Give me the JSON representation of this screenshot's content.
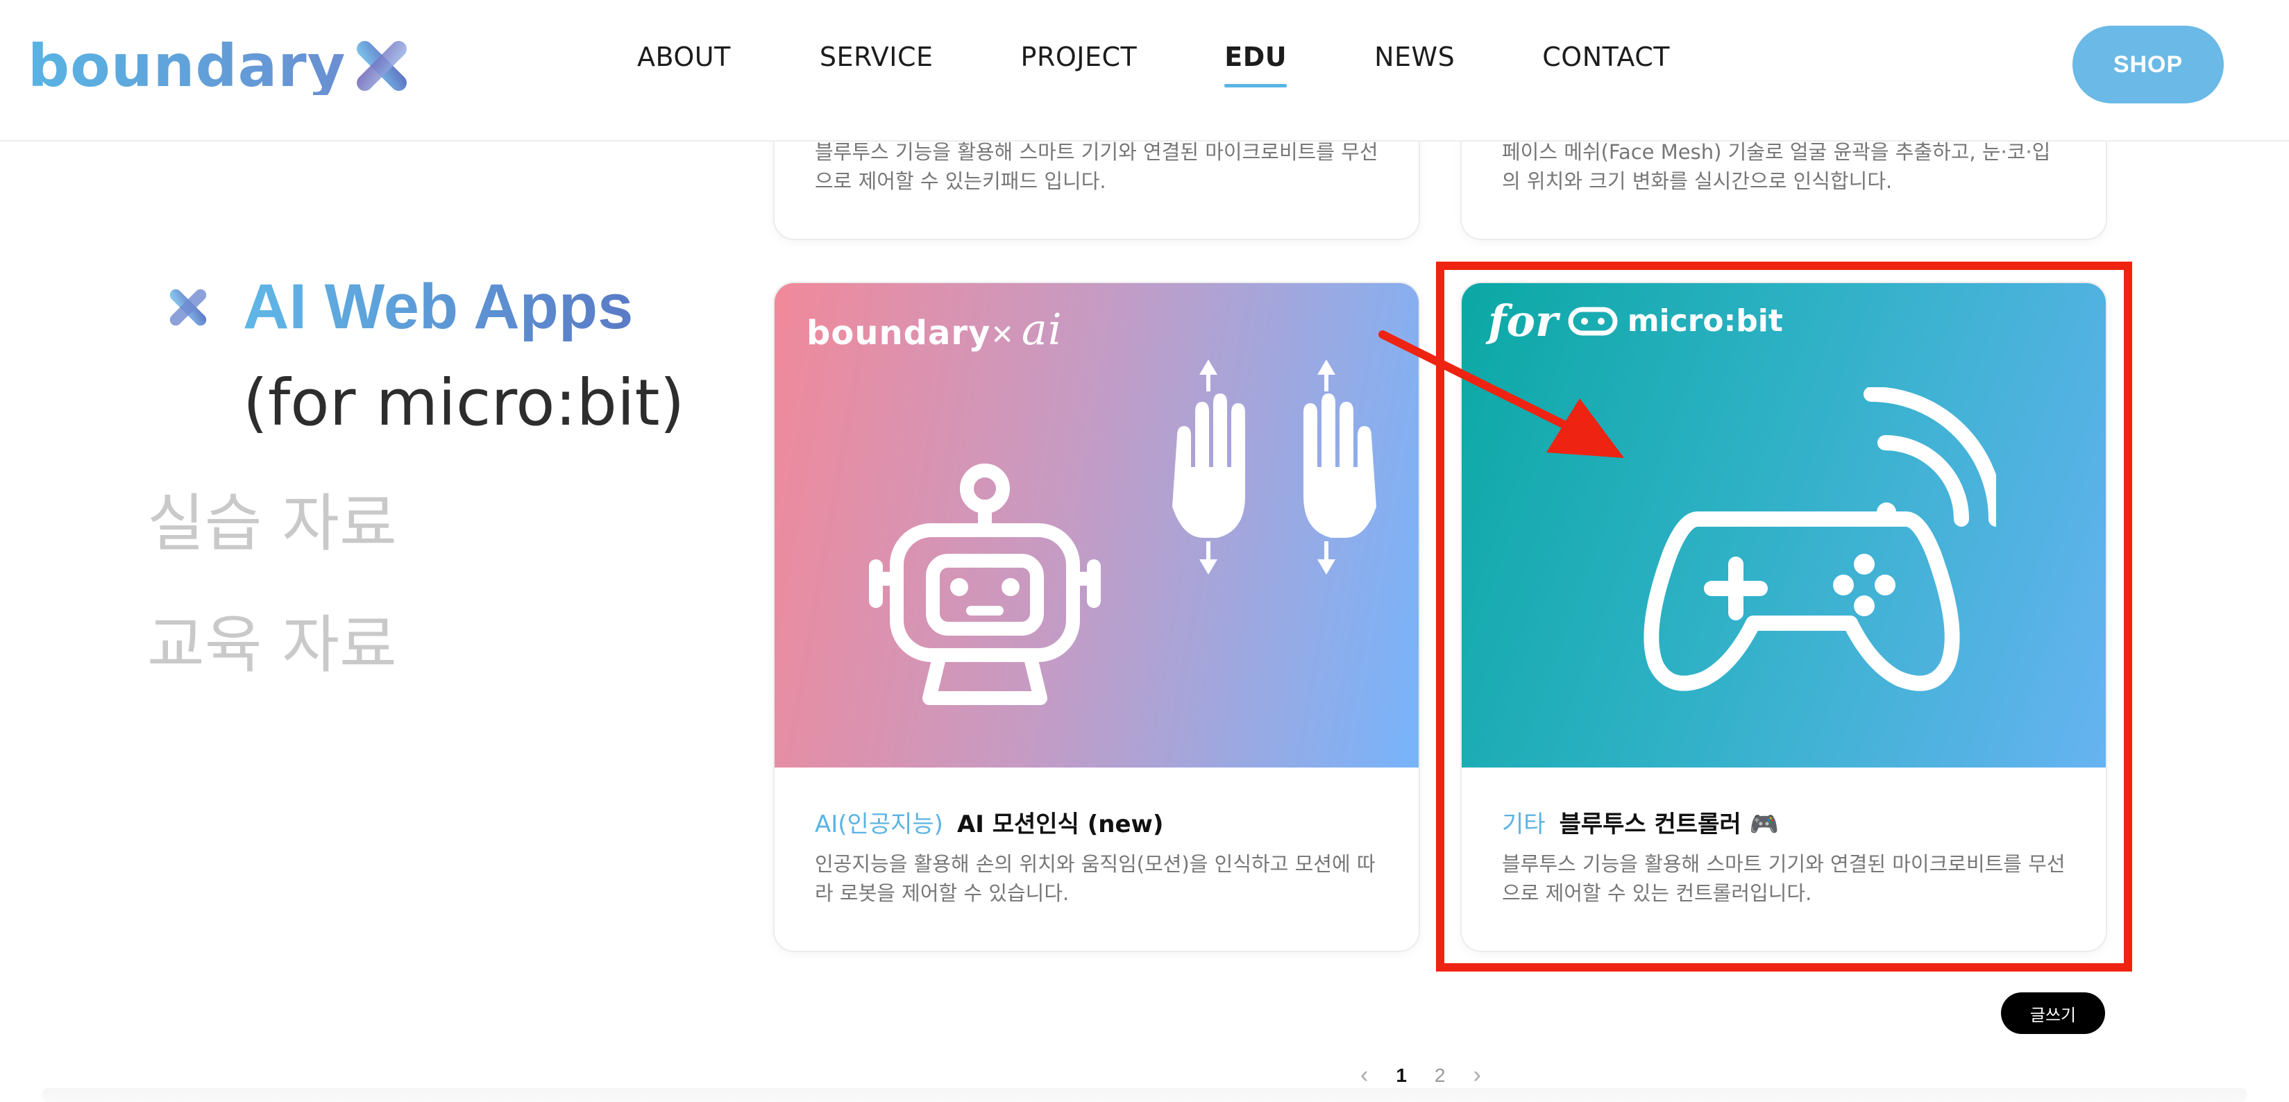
{
  "brand": {
    "logo_text": "boundary"
  },
  "nav": {
    "items": [
      {
        "label": "ABOUT"
      },
      {
        "label": "SERVICE"
      },
      {
        "label": "PROJECT"
      },
      {
        "label": "EDU"
      },
      {
        "label": "NEWS"
      },
      {
        "label": "CONTACT"
      }
    ],
    "active": "EDU",
    "shop_label": "SHOP"
  },
  "sidebar": {
    "title": "AI Web Apps",
    "subtitle": "(for micro:bit)",
    "links": [
      {
        "label": "실습 자료"
      },
      {
        "label": "교육 자료"
      }
    ]
  },
  "top_cards": [
    {
      "description": "블루투스 기능을 활용해 스마트 기기와 연결된 마이크로비트를 무선으로 제어할 수 있는키패드 입니다."
    },
    {
      "description": "페이스 메쉬(Face Mesh) 기술로 얼굴 윤곽을 추출하고, 눈·코·입의 위치와 크기 변화를 실시간으로 인식합니다."
    }
  ],
  "cards": [
    {
      "thumb_brand": "boundary",
      "thumb_brand_ai": "ai",
      "category": "AI(인공지능)",
      "title": "AI 모션인식 (new)",
      "description": "인공지능을 활용해 손의 위치와 움직임(모션)을 인식하고 모션에 따라 로봇을 제어할 수 있습니다."
    },
    {
      "thumb_for": "for",
      "thumb_microbit": "micro:bit",
      "category": "기타",
      "title": "블루투스 컨트롤러 🎮",
      "description": "블루투스 기능을 활용해 스마트 기기와 연결된 마이크로비트를 무선으로 제어할 수 있는 컨트롤러입니다."
    }
  ],
  "write_button": "글쓰기",
  "pagination": {
    "current": "1",
    "next": "2"
  },
  "colors": {
    "accent": "#5ab4e3",
    "highlight": "#ee2312",
    "shop": "#6ab9e6"
  }
}
